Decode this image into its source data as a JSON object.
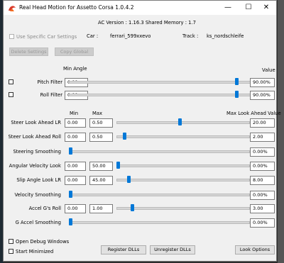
{
  "window": {
    "title": "Real Head Motion for Assetto Corsa 1.0.4.2",
    "controls": {
      "minimize": "—",
      "maximize": "☐",
      "close": "✕"
    }
  },
  "info": {
    "ac_version": "AC Version : 1.16.3  Shared Memory : 1.7",
    "use_specific_car": "Use Specific Car Settings",
    "car_label": "Car :",
    "car_value": "ferrari_599xxevo",
    "track_label": "Track :",
    "track_value": "ks_nordschleife"
  },
  "buttons": {
    "delete_settings": "Delete Settings",
    "copy_global": "Copy Global",
    "register_dlls": "Register DLLs",
    "unregister_dlls": "Unregister DLLs",
    "look_options": "Look Options"
  },
  "headers": {
    "min_angle": "Min Angle",
    "value": "Value",
    "min": "Min",
    "max": "Max",
    "max_look_ahead_value": "Max Look Ahead Value"
  },
  "filters": [
    {
      "label": "Pitch Filter",
      "min_angle": "0.00",
      "value": "90.00%",
      "level": 0.92
    },
    {
      "label": "Roll Filter",
      "min_angle": "0.00",
      "value": "90.00%",
      "level": 0.92
    }
  ],
  "look_rows": [
    {
      "label": "Steer Look Ahead LR",
      "min": "0.00",
      "max": "0.50",
      "value": "20.00",
      "level": 0.47
    },
    {
      "label": "Steer Look Ahead Roll",
      "min": "0.00",
      "max": "0.50",
      "value": "2.00",
      "level": 0.05
    },
    {
      "label": "Steering Smoothing",
      "value": "0.00%",
      "level": 0.0
    },
    {
      "label": "Angular Velocity Look",
      "min": "0.00",
      "max": "50.00",
      "value": "0.00%",
      "level": 0.0
    },
    {
      "label": "Slip Angle Look LR",
      "min": "0.00",
      "max": "45.00",
      "value": "8.00",
      "level": 0.08
    },
    {
      "label": "Velocity Smoothing",
      "value": "0.00%",
      "level": 0.0
    },
    {
      "label": "Accel G's  Roll",
      "min": "0.00",
      "max": "1.00",
      "value": "3.00",
      "level": 0.11
    },
    {
      "label": "G Accel Smoothing",
      "value": "0.00%",
      "level": 0.0
    }
  ],
  "options": {
    "open_debug_windows": "Open Debug Windows",
    "start_minimized": "Start Minimized"
  },
  "colors": {
    "accent": "#0078d7",
    "window_bg": "#f0f0f0"
  }
}
